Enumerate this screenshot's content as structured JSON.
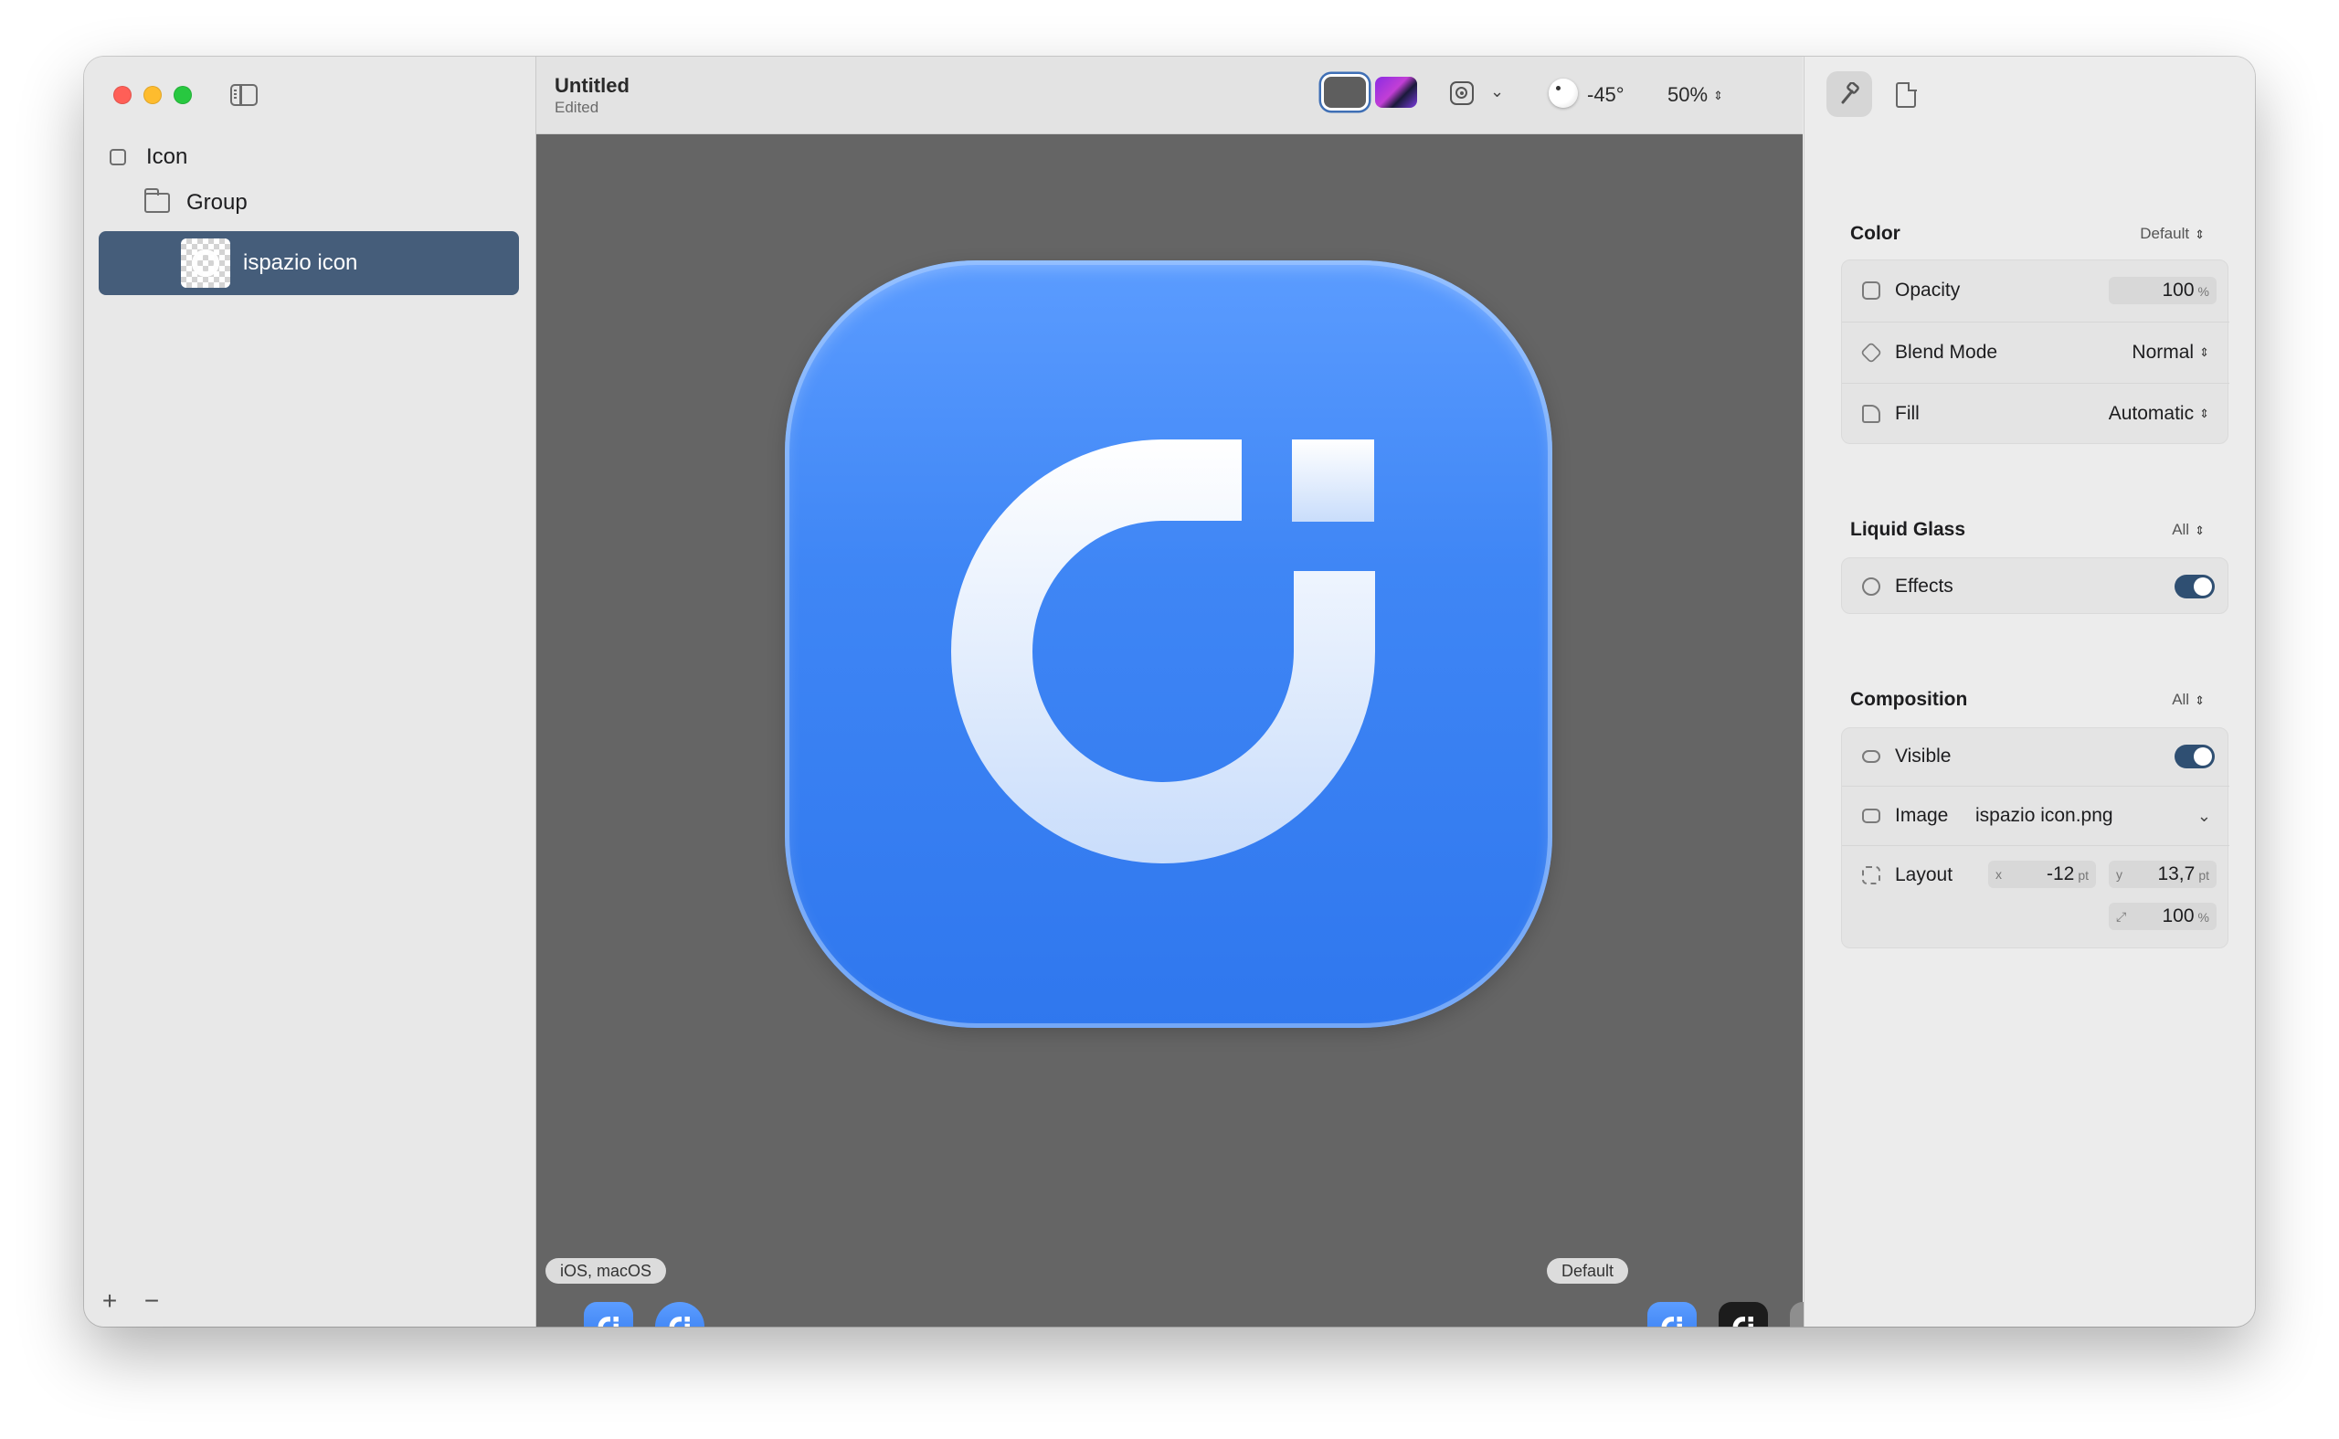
{
  "sidebar": {
    "items": [
      {
        "label": "Icon"
      },
      {
        "label": "Group"
      },
      {
        "label": "ispazio icon"
      }
    ],
    "add_label": "+",
    "remove_label": "−"
  },
  "toolbar": {
    "title": "Untitled",
    "subtitle": "Edited",
    "light_angle": "-45°",
    "zoom": "50%"
  },
  "canvas": {
    "platform_label": "iOS, macOS",
    "appearance_label": "Default",
    "icon_color": "#3a80f3"
  },
  "inspector": {
    "color": {
      "title": "Color",
      "option": "Default",
      "opacity_label": "Opacity",
      "opacity_value": "100",
      "opacity_unit": "%",
      "blend_label": "Blend Mode",
      "blend_value": "Normal",
      "fill_label": "Fill",
      "fill_value": "Automatic"
    },
    "liquid_glass": {
      "title": "Liquid Glass",
      "option": "All",
      "effects_label": "Effects",
      "effects_on": true
    },
    "composition": {
      "title": "Composition",
      "option": "All",
      "visible_label": "Visible",
      "visible_on": true,
      "image_label": "Image",
      "image_value": "ispazio icon.png",
      "layout_label": "Layout",
      "x_axis": "x",
      "x_value": "-12",
      "y_axis": "y",
      "y_value": "13,7",
      "unit_pt": "pt",
      "scale_value": "100",
      "scale_unit": "%"
    }
  }
}
